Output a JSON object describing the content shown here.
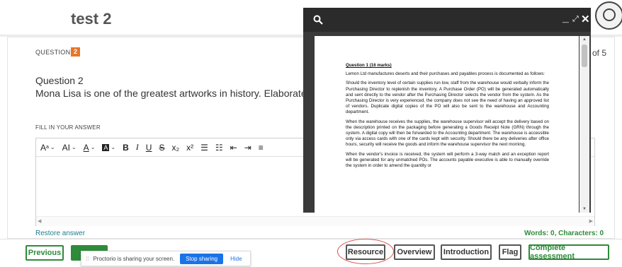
{
  "header": {
    "title": "test 2"
  },
  "question": {
    "label": "QUESTION",
    "number": "2",
    "count_fragment": "of 5",
    "title": "Question 2",
    "text": "Mona Lisa is one of the greatest artworks in history. Elaborate"
  },
  "answer": {
    "label": "FILL IN YOUR ANSWER",
    "toolbar": {
      "font_size": "A",
      "font_family": "AI",
      "font_color": "A",
      "highlight": "A",
      "bold": "B",
      "italic": "I",
      "underline": "U",
      "strike": "S",
      "subscript": "x₂",
      "superscript": "x²"
    },
    "restore_label": "Restore answer",
    "words_label": "Words: 0, Characters: 0"
  },
  "buttons": {
    "previous": "Previous",
    "next": "",
    "resource": "Resource",
    "overview": "Overview",
    "introduction": "Introduction",
    "flag": "Flag",
    "complete": "Complete assessment"
  },
  "share_banner": {
    "message": "Proctorio is sharing your screen.",
    "stop": "Stop sharing",
    "hide": "Hide"
  },
  "viewer": {
    "min_symbol": "_",
    "max_symbol": "⤢",
    "close_symbol": "✕",
    "document": {
      "heading": "Question 1 (16 marks)",
      "paragraphs": [
        "Lemon Ltd manufactures deserts and their purchases and payables process is documented as follows:",
        "Should the inventory level of certain supplies run low, staff from the warehouse would verbally inform the Purchasing Director to replenish the inventory. A Purchase Order (PO) will be generated automatically and sent directly to the vendor after the Purchasing Director selects the vendor from the system. As the Purchasing Director is very experienced, the company does not see the need of having an approved list of vendors. Duplicate digital copies of the PO will also be sent to the warehouse and Accounting department.",
        "When the warehouse receives the supplies, the warehouse supervisor will accept the delivery based on the description printed on the packaging before generating a Goods Receipt Note (GRN) through the system. A digital copy will then be forwarded to the Accounting department. The warehouse is accessible only via access cards with one of the cards kept with security. Should there be any deliveries after office hours, security will receive the goods and inform the warehouse supervisor the next morning.",
        "When the vendor's invoice is received, the system will perform a 3-way match and an exception report will be generated for any unmatched POs. The accounts payable executive is able to manually override the system in order to amend the quantity or"
      ]
    }
  },
  "colors": {
    "accent_green": "#2e8b3a",
    "badge_orange": "#e8762b",
    "viewer_dark": "#3a3a3a",
    "share_blue": "#1a73e8"
  }
}
